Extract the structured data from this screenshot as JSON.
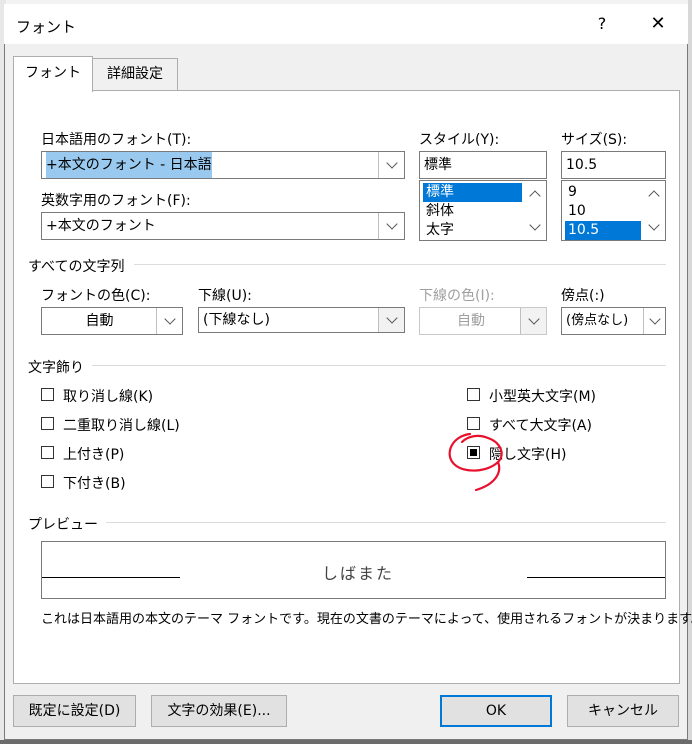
{
  "dialog": {
    "title": "フォント",
    "help_label": "?",
    "close_label": "✕"
  },
  "tabs": [
    {
      "label": "フォント",
      "active": true
    },
    {
      "label": "詳細設定",
      "active": false
    }
  ],
  "japanese_font": {
    "label": "日本語用のフォント(T):",
    "value": "+本文のフォント - 日本語"
  },
  "latin_font": {
    "label": "英数字用のフォント(F):",
    "value": "+本文のフォント"
  },
  "style": {
    "label": "スタイル(Y):",
    "value": "標準",
    "options": [
      "標準",
      "斜体",
      "太字"
    ],
    "selected": "標準"
  },
  "size": {
    "label": "サイズ(S):",
    "value": "10.5",
    "options": [
      "9",
      "10",
      "10.5"
    ],
    "selected": "10.5"
  },
  "all_text": {
    "header": "すべての文字列",
    "font_color_label": "フォントの色(C):",
    "font_color_value": "自動",
    "underline_label": "下線(U):",
    "underline_value": "(下線なし)",
    "underline_color_label": "下線の色(I):",
    "underline_color_value": "自動",
    "emphasis_label": "傍点(:)",
    "emphasis_value": "(傍点なし)"
  },
  "effects": {
    "header": "文字飾り",
    "left": [
      {
        "label": "取り消し線(K)",
        "checked": false
      },
      {
        "label": "二重取り消し線(L)",
        "checked": false
      },
      {
        "label": "上付き(P)",
        "checked": false
      },
      {
        "label": "下付き(B)",
        "checked": false
      }
    ],
    "right": [
      {
        "label": "小型英大文字(M)",
        "checked": false
      },
      {
        "label": "すべて大文字(A)",
        "checked": false
      },
      {
        "label": "隠し文字(H)",
        "checked": true
      }
    ],
    "annotation_color": "#e8112d"
  },
  "preview": {
    "header": "プレビュー",
    "sample_text": "しばまた",
    "description": "これは日本語用の本文のテーマ フォントです。現在の文書のテーマによって、使用されるフォントが決まります。"
  },
  "buttons": {
    "set_default": "既定に設定(D)",
    "text_effects": "文字の効果(E)...",
    "ok": "OK",
    "cancel": "キャンセル"
  },
  "colors": {
    "accent": "#0078d7",
    "selection_highlight": "#99c9ef",
    "dialog_bg": "#f0f0f0"
  }
}
